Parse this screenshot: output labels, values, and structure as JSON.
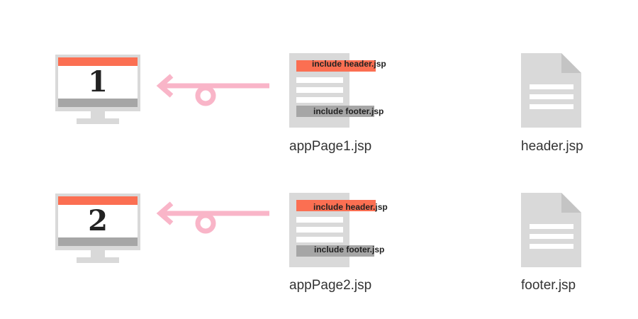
{
  "rows": [
    {
      "monitor_number": "1",
      "jsp": {
        "include_header": "include header.jsp",
        "include_footer": "include footer.jsp",
        "name": "appPage1.jsp"
      },
      "file_name": "header.jsp"
    },
    {
      "monitor_number": "2",
      "jsp": {
        "include_header": "include header.jsp",
        "include_footer": "include footer.jsp",
        "name": "appPage2.jsp"
      },
      "file_name": "footer.jsp"
    }
  ],
  "colors": {
    "header_bar": "#fb6f52",
    "footer_bar": "#a6a6a6",
    "arrow": "#f9b5c8",
    "icon_gray": "#d9d9d9"
  },
  "icons": {
    "monitor": "monitor-icon",
    "arrow": "loop-arrow-left-icon",
    "file": "file-icon"
  }
}
